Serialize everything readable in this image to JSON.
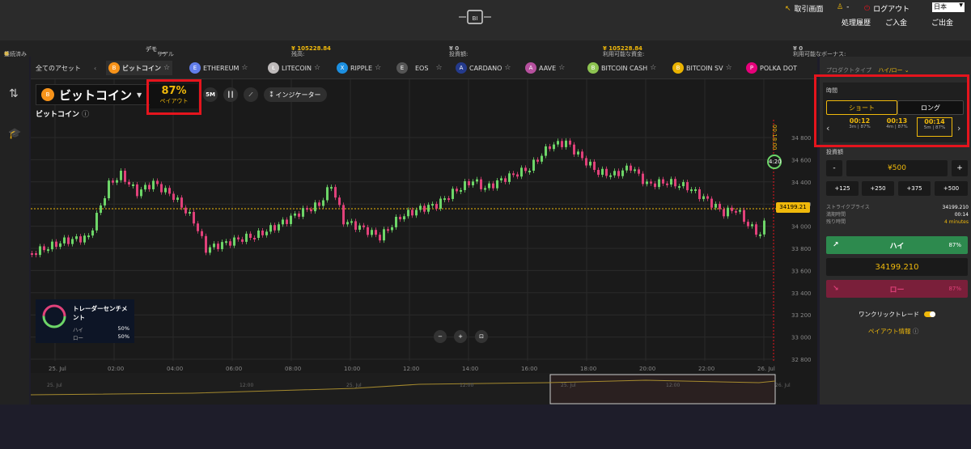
{
  "header": {
    "trade_screen": "取引画面",
    "user": "-",
    "logout": "ログアウト",
    "language": "日本",
    "history": "処理履歴",
    "deposit": "ご入金",
    "withdraw": "ご出金"
  },
  "status_bar": {
    "connection": "接続済み",
    "demo": "デモ",
    "real": "リアル",
    "balance_label": "残高:",
    "balance_value": "¥ 105228.84",
    "invest_label": "投資額:",
    "invest_value": "¥ 0",
    "available_label": "利用可能な資金:",
    "available_value": "¥ 105228.84",
    "bonus_label": "利用可能なボーナス:",
    "bonus_value": "¥ 0"
  },
  "assets": {
    "all": "全てのアセット",
    "tabs": [
      {
        "label": "ビットコイン",
        "icon": "B",
        "color": "#f7931a"
      },
      {
        "label": "ETHEREUM",
        "icon": "E",
        "color": "#627eea"
      },
      {
        "label": "LITECOIN",
        "icon": "Ł",
        "color": "#bfbbbb"
      },
      {
        "label": "RIPPLE",
        "icon": "X",
        "color": "#1c8fe0"
      },
      {
        "label": "EOS",
        "icon": "E",
        "color": "#555"
      },
      {
        "label": "CARDANO",
        "icon": "A",
        "color": "#243a8c"
      },
      {
        "label": "AAVE",
        "icon": "A",
        "color": "#b6509e"
      },
      {
        "label": "BITCOIN CASH",
        "icon": "B",
        "color": "#8dc351"
      },
      {
        "label": "BITCOIN SV",
        "icon": "B",
        "color": "#eab300"
      },
      {
        "label": "POLKA DOT",
        "icon": "P",
        "color": "#e6007a"
      }
    ]
  },
  "chart_header": {
    "asset": "ビットコイン",
    "payout_pct": "87%",
    "payout_label": "ペイアウト",
    "timeframe": "5M",
    "indicator": "インジケーター",
    "subtitle": "ビットコイン"
  },
  "chart": {
    "current_price": "34199.21",
    "timer": "00:18:00",
    "countdown": "4:20",
    "y_ticks": [
      "34 800",
      "34 600",
      "34 400",
      "34 200",
      "34 000",
      "33 800",
      "33 600",
      "33 400",
      "33 200",
      "33 000",
      "32 800"
    ],
    "x_ticks": [
      "25. Jul",
      "02:00",
      "04:00",
      "06:00",
      "08:00",
      "10:00",
      "12:00",
      "14:00",
      "16:00",
      "18:00",
      "20:00",
      "22:00",
      "26. Jul"
    ],
    "nav_ticks": [
      "25. Jul",
      "12:00",
      "25. Jul",
      "12:00",
      "25. Jul",
      "12:00",
      "26. Jul"
    ]
  },
  "sentiment": {
    "title": "トレーダーセンチメント",
    "high_label": "ハイ",
    "high_value": "50%",
    "low_label": "ロー",
    "low_value": "50%"
  },
  "panel": {
    "product_type_label": "プロダクトタイプ",
    "product_type_value": "ハイ/ロー",
    "time_label": "時間",
    "short": "ショート",
    "long": "ロング",
    "times": [
      {
        "time": "00:12",
        "sub": "3m | 87%"
      },
      {
        "time": "00:13",
        "sub": "4m | 87%"
      },
      {
        "time": "00:14",
        "sub": "5m | 87%"
      }
    ],
    "invest_label": "投資額",
    "minus": "-",
    "amount": "¥500",
    "plus": "+",
    "quick": [
      "+125",
      "+250",
      "+375",
      "+500"
    ],
    "strike_label": "ストライクプライス",
    "strike_value": "34199.210",
    "expiry_label": "満期時間",
    "expiry_value": "00:14",
    "remain_label": "残り時間",
    "remain_value": "4 minutes",
    "high_btn": "ハイ",
    "high_pct": "87%",
    "price": "34199.210",
    "low_btn": "ロー",
    "low_pct": "87%",
    "one_click": "ワンクリックトレード",
    "payout_info": "ペイアウト情報"
  },
  "colors": {
    "up": "#6dd568",
    "down": "#e0417a",
    "accent": "#f0b90b",
    "highlight": "#e5141d",
    "high_btn": "#2d8a4e",
    "low_btn": "#7a1f3a"
  }
}
